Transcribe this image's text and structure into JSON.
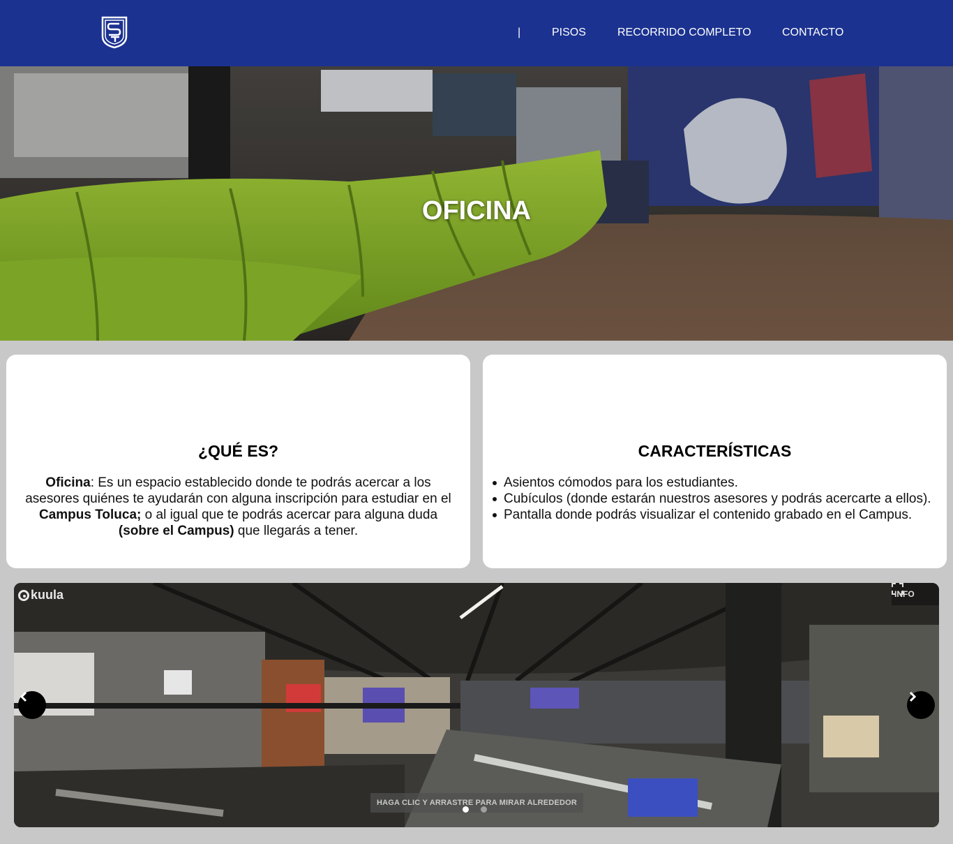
{
  "header": {
    "logo_icon": "campus-shield-logo",
    "separator": "|",
    "nav": [
      "PISOS",
      "RECORRIDO COMPLETO",
      "CONTACTO"
    ]
  },
  "hero": {
    "title": "OFICINA"
  },
  "que_es": {
    "title": "¿QUÉ ES?",
    "p1_bold": "Oficina",
    "p1_text": ": Es un espacio establecido donde te podrás acercar a los asesores quiénes te ayudarán con alguna inscripción para estudiar en el ",
    "p1_bold2": "Campus Toluca;",
    "p1_text2": " o al igual que te podrás acercar para alguna duda ",
    "p1_bold3": "(sobre el Campus)",
    "p1_text3": " que llegarás a tener."
  },
  "caracteristicas": {
    "title": "CARACTERÍSTICAS",
    "items": [
      "Asientos cómodos para los estudiantes.",
      "Cubículos (donde estarán nuestros asesores y podrás acercarte a ellos).",
      "Pantalla donde podrás visualizar el contenido grabado en el Campus."
    ]
  },
  "viewer": {
    "brand": "kuula",
    "info_label": "INFO",
    "hint": "HAGA CLIC Y ARRASTRE PARA MIRAR ALREDEDOR",
    "slides": 2,
    "active_slide": 1,
    "prev_icon": "chevron-left-icon",
    "next_icon": "chevron-right-icon",
    "fullscreen_icon": "fullscreen-icon"
  },
  "colors": {
    "header_bg": "#1b3290",
    "page_bg": "#c8c8c8",
    "card_bg": "#ffffff"
  }
}
